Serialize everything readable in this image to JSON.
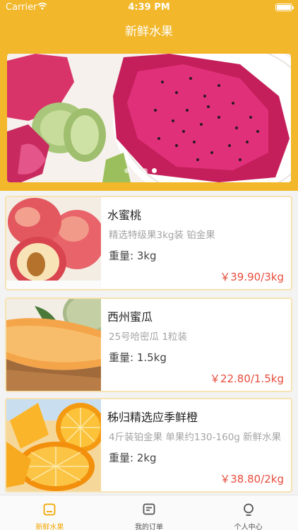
{
  "status_bar": {
    "carrier": "Carrier",
    "time": "4:39 PM"
  },
  "nav": {
    "title": "新鲜水果"
  },
  "banner": {
    "page_count": 4,
    "active_page": 4
  },
  "products": [
    {
      "name": "水蜜桃",
      "description": "精选特级果3kg装 铂金果",
      "weight": "重量: 3kg",
      "price": "￥39.90/3kg"
    },
    {
      "name": "西州蜜瓜",
      "description": "25号哈密瓜 1粒装",
      "weight": "重量: 1.5kg",
      "price": "￥22.80/1.5kg"
    },
    {
      "name": "秭归精选应季鲜橙",
      "description": "4斤装铂金果 单果约130-160g 新鲜水果",
      "weight": "重量: 2kg",
      "price": "￥38.80/2kg"
    }
  ],
  "tabbar": {
    "items": [
      {
        "label": "新鲜水果",
        "icon": "home-icon",
        "active": true
      },
      {
        "label": "我的订单",
        "icon": "orders-icon",
        "active": false
      },
      {
        "label": "个人中心",
        "icon": "profile-icon",
        "active": false
      }
    ]
  },
  "colors": {
    "accent": "#f2b72a",
    "price": "#e74c3c",
    "card_border": "#f6e2b2"
  }
}
